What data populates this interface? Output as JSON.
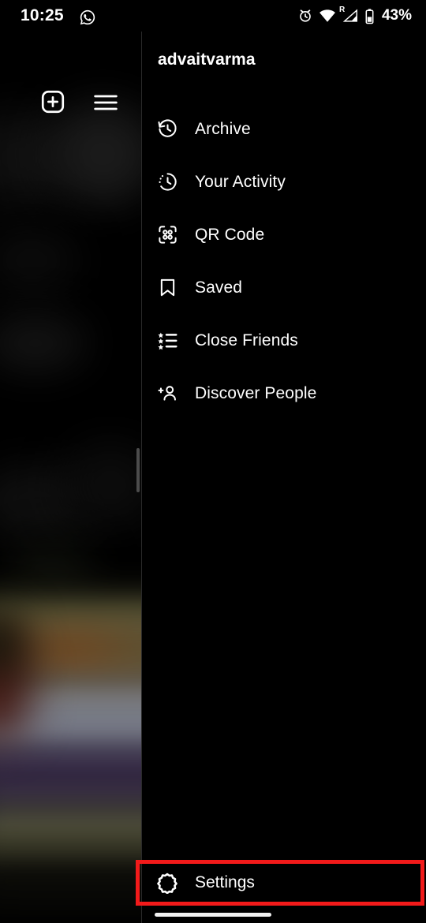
{
  "status_bar": {
    "time": "10:25",
    "notification_icons": [
      "whatsapp-icon"
    ],
    "alarm_icon": "alarm-clock-icon",
    "wifi_icon": "wifi-icon",
    "signal_icon": "cellular-signal-roaming-icon",
    "roaming_label": "R",
    "battery_icon": "battery-icon",
    "battery_percent": "43%"
  },
  "background": {
    "add_post_icon": "plus-square-icon",
    "hamburger_icon": "hamburger-menu-icon"
  },
  "drawer": {
    "username": "advaitvarma",
    "menu_items": [
      {
        "label": "Archive",
        "icon": "archive-clock-icon"
      },
      {
        "label": "Your Activity",
        "icon": "activity-clock-icon"
      },
      {
        "label": "QR Code",
        "icon": "qr-code-icon"
      },
      {
        "label": "Saved",
        "icon": "bookmark-icon"
      },
      {
        "label": "Close Friends",
        "icon": "star-list-icon"
      },
      {
        "label": "Discover People",
        "icon": "person-add-icon"
      }
    ],
    "settings": {
      "label": "Settings",
      "icon": "gear-icon"
    }
  },
  "annotation": {
    "highlight_color": "#f21a1a",
    "highlight_target": "Settings"
  },
  "colors": {
    "background": "#000000",
    "text": "#ffffff",
    "divider": "#2a2a2a",
    "scrollbar": "#4c4c4c"
  }
}
